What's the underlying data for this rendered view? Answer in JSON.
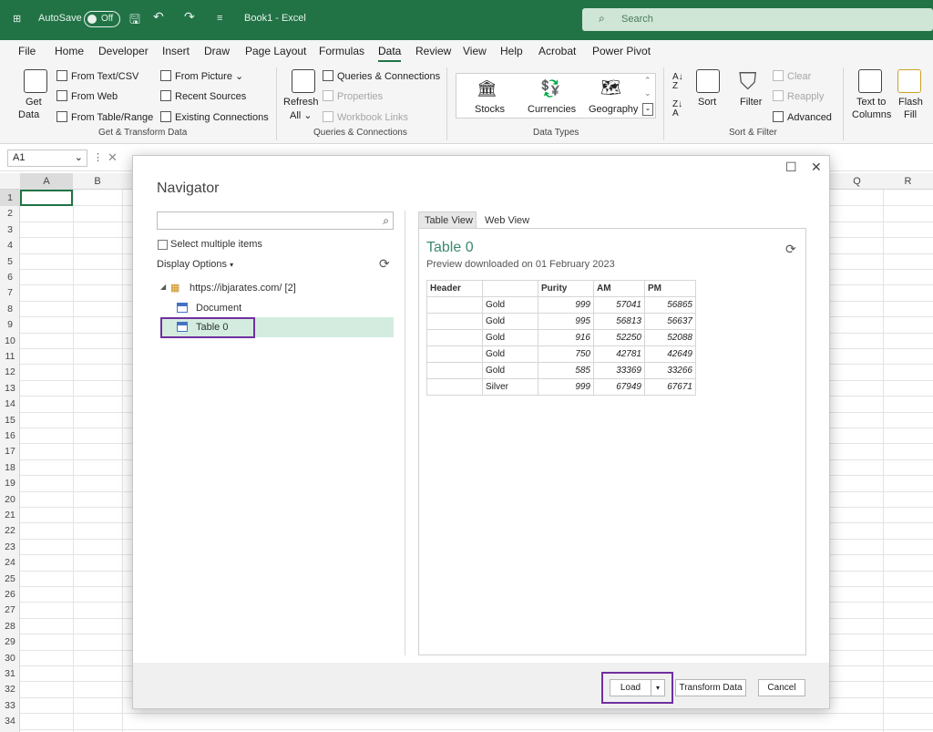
{
  "titlebar": {
    "autosave": "AutoSave",
    "autosave_state": "Off",
    "doc_title": "Book1 - Excel",
    "search_placeholder": "Search"
  },
  "menu": [
    "File",
    "Home",
    "Developer",
    "Insert",
    "Draw",
    "Page Layout",
    "Formulas",
    "Data",
    "Review",
    "View",
    "Help",
    "Acrobat",
    "Power Pivot"
  ],
  "ribbon": {
    "get_data": "Get",
    "get_data2": "Data",
    "from_text": "From Text/CSV",
    "from_web": "From Web",
    "from_table": "From Table/Range",
    "from_picture": "From Picture",
    "recent_sources": "Recent Sources",
    "existing_connections": "Existing Connections",
    "group_get": "Get & Transform Data",
    "refresh": "Refresh",
    "refresh2": "All",
    "queries": "Queries & Connections",
    "properties": "Properties",
    "workbook_links": "Workbook Links",
    "group_queries": "Queries & Connections",
    "stocks": "Stocks",
    "currencies": "Currencies",
    "geography": "Geography",
    "group_types": "Data Types",
    "sort": "Sort",
    "filter": "Filter",
    "clear": "Clear",
    "reapply": "Reapply",
    "advanced": "Advanced",
    "group_sort": "Sort & Filter",
    "text_to": "Text to",
    "columns": "Columns",
    "flash": "Flash",
    "fill": "Fill"
  },
  "namebox": "A1",
  "columns": [
    "A",
    "B",
    "Q",
    "R"
  ],
  "rows": [
    "1",
    "2",
    "3",
    "4",
    "5",
    "6",
    "7",
    "8",
    "9",
    "10",
    "11",
    "12",
    "13",
    "14",
    "15",
    "16",
    "17",
    "18",
    "19",
    "20",
    "21",
    "22",
    "23",
    "24",
    "25",
    "26",
    "27",
    "28",
    "29",
    "30",
    "31",
    "32",
    "33",
    "34"
  ],
  "navigator": {
    "title": "Navigator",
    "select_multiple": "Select multiple items",
    "display_options": "Display Options",
    "tree_root": "https://ibjarates.com/ [2]",
    "tree_items": [
      "Document",
      "Table 0"
    ],
    "tab_table": "Table View",
    "tab_web": "Web View",
    "preview_title": "Table 0",
    "preview_sub": "Preview downloaded on 01 February 2023",
    "headers": [
      "Header",
      "",
      "Purity",
      "AM",
      "PM"
    ],
    "rows": [
      [
        "",
        "Gold",
        "999",
        "57041",
        "56865"
      ],
      [
        "",
        "Gold",
        "995",
        "56813",
        "56637"
      ],
      [
        "",
        "Gold",
        "916",
        "52250",
        "52088"
      ],
      [
        "",
        "Gold",
        "750",
        "42781",
        "42649"
      ],
      [
        "",
        "Gold",
        "585",
        "33369",
        "33266"
      ],
      [
        "",
        "Silver",
        "999",
        "67949",
        "67671"
      ]
    ],
    "load": "Load",
    "transform": "Transform Data",
    "cancel": "Cancel"
  },
  "colors": {
    "excel_green": "#217346",
    "highlight_purple": "#7030a0",
    "selected_row": "#d3ecdf"
  }
}
